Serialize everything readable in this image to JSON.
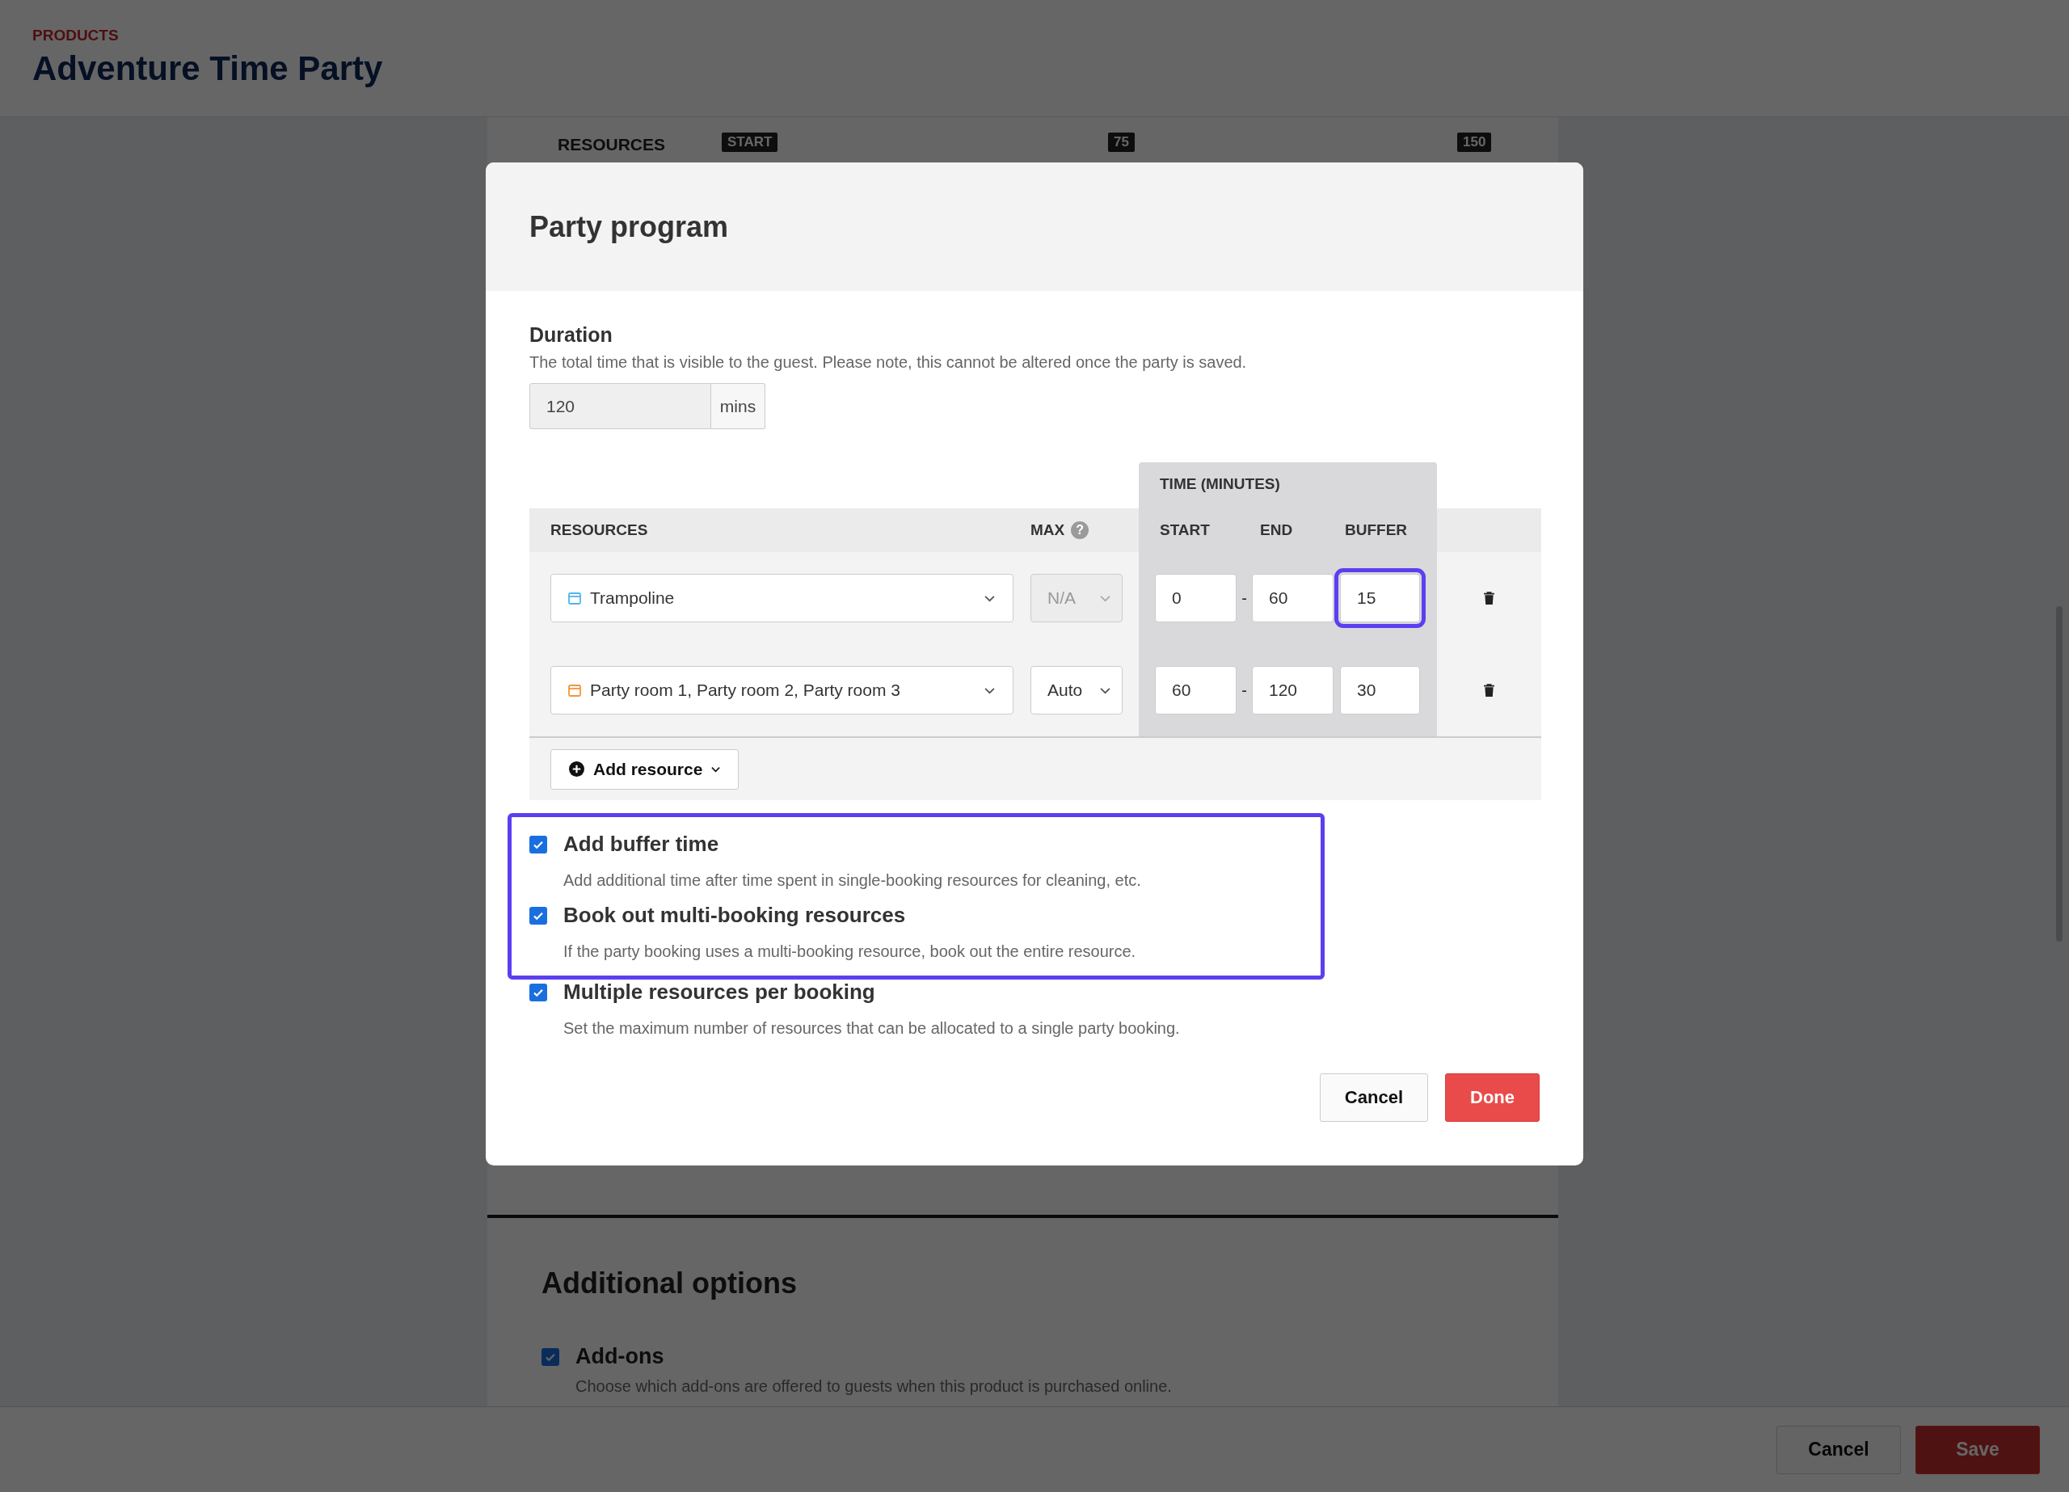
{
  "page": {
    "breadcrumb": "PRODUCTS",
    "title": "Adventure Time Party"
  },
  "background_section": {
    "resources_label": "RESOURCES",
    "timeline_markers": [
      "START",
      "75",
      "150"
    ]
  },
  "additional_options": {
    "title": "Additional options",
    "options": [
      {
        "label": "Add-ons",
        "description": "Choose which add-ons are offered to guests when this product is purchased online.",
        "checked": true
      }
    ]
  },
  "footer": {
    "buttons": [
      {
        "label": "Cancel",
        "kind": "secondary"
      },
      {
        "label": "Save",
        "kind": "primary"
      }
    ]
  },
  "modal": {
    "title": "Party program",
    "duration": {
      "label": "Duration",
      "description": "The total time that is visible to the guest. Please note, this cannot be altered once the party is saved.",
      "value": "120",
      "unit": "mins"
    },
    "table": {
      "group_header": "TIME (MINUTES)",
      "columns": [
        "RESOURCES",
        "MAX",
        "START",
        "END",
        "BUFFER"
      ],
      "max_help": "?",
      "range_separator": "-",
      "rows": [
        {
          "resource": "Trampoline",
          "color": "#4fb6ee",
          "max": "N/A",
          "max_disabled": true,
          "start": "0",
          "end": "60",
          "buffer": "15",
          "buffer_highlighted": true
        },
        {
          "resource": "Party room 1, Party room 2, Party room 3",
          "color": "#f5953a",
          "max": "Auto",
          "max_disabled": false,
          "start": "60",
          "end": "120",
          "buffer": "30",
          "buffer_highlighted": false
        }
      ],
      "add_button": "Add resource"
    },
    "options": [
      {
        "label": "Add buffer time",
        "description": "Add additional time after time spent in single-booking resources for cleaning, etc.",
        "checked": true,
        "highlighted": true
      },
      {
        "label": "Book out multi-booking resources",
        "description": "If the party booking uses a multi-booking resource, book out the entire resource.",
        "checked": true,
        "highlighted": true
      },
      {
        "label": "Multiple resources per booking",
        "description": "Set the maximum number of resources that can be allocated to a single party booking.",
        "checked": true,
        "highlighted": false
      }
    ],
    "buttons": [
      {
        "label": "Cancel",
        "kind": "secondary"
      },
      {
        "label": "Done",
        "kind": "primary"
      }
    ]
  }
}
